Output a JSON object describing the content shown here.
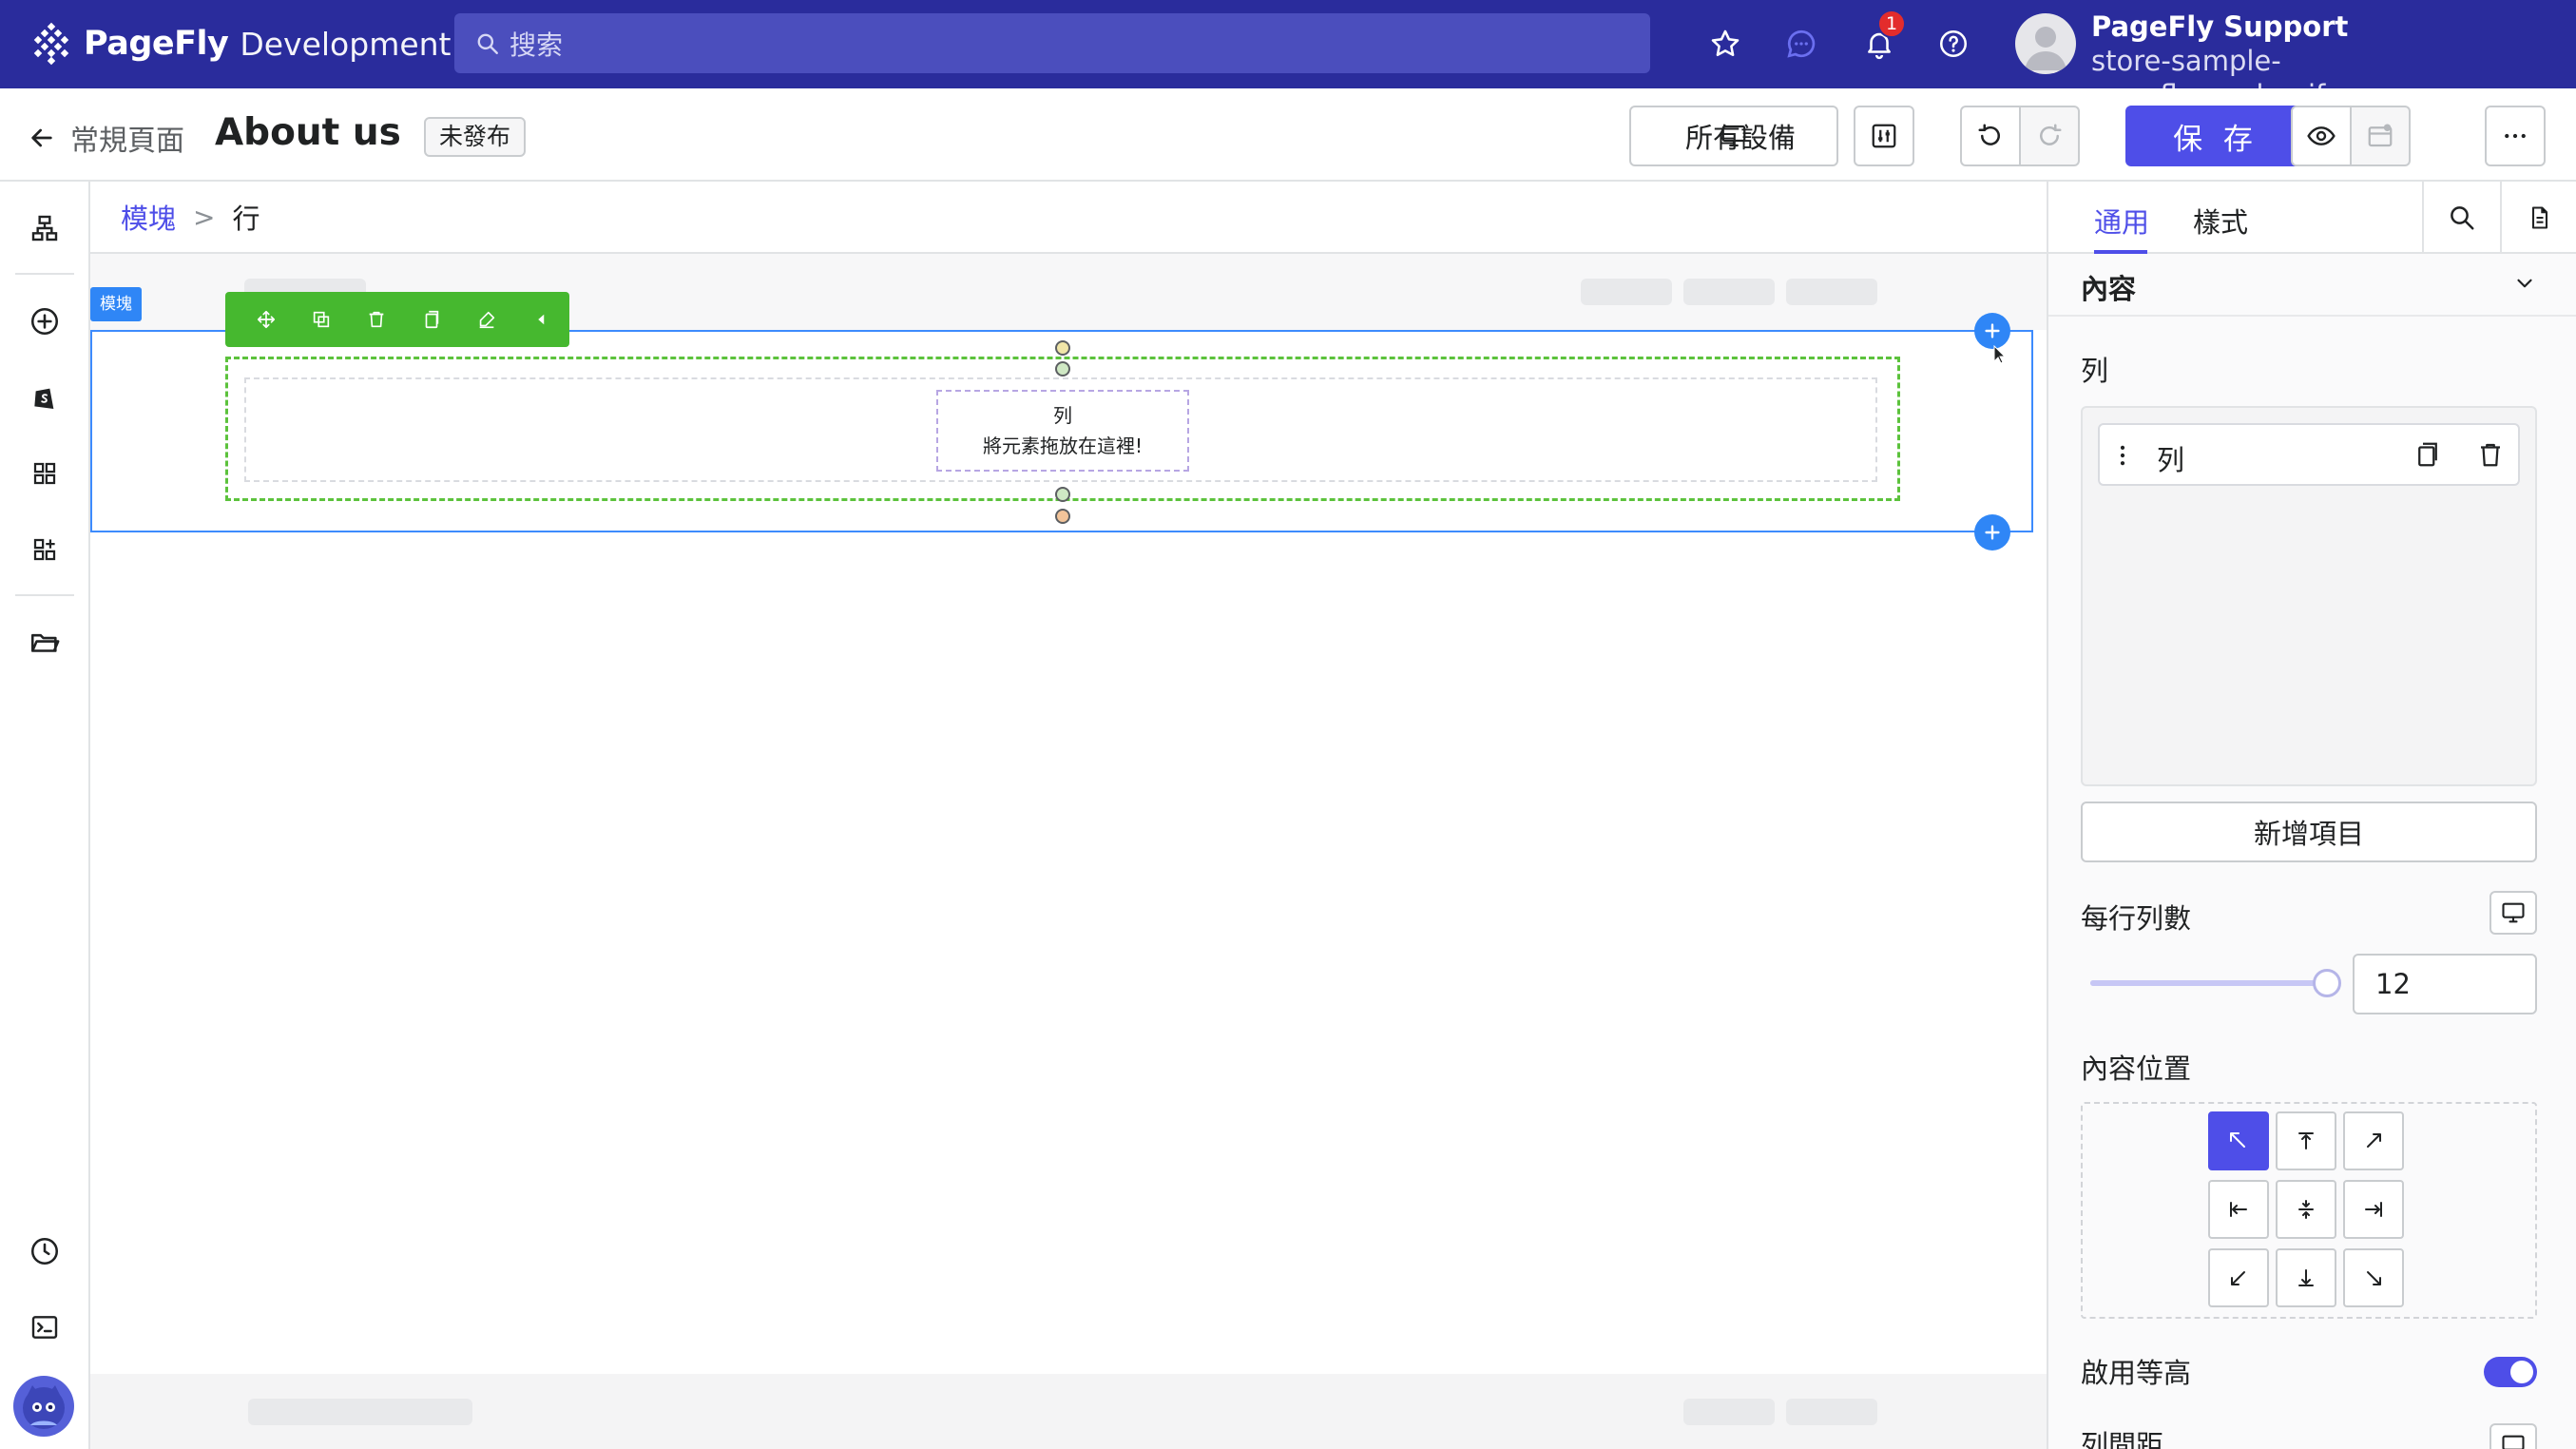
{
  "topbar": {
    "brand_name": "PageFly",
    "brand_suffix": "Development",
    "search_placeholder": "搜索",
    "notification_count": "1",
    "user_name": "PageFly Support",
    "user_store": "store-sample-pagefly.myshopify.com"
  },
  "header": {
    "back_label": "常規頁面",
    "page_title": "About us",
    "status_badge": "未發布",
    "device_label": "所有設備",
    "save_label": "保 存"
  },
  "breadcrumb": {
    "parent": "模塊",
    "separator": ">",
    "current": "行"
  },
  "canvas": {
    "section_tag": "模塊",
    "column_label": "列",
    "drop_hint": "將元素拖放在這裡!"
  },
  "panel": {
    "tab_general": "通用",
    "tab_style": "樣式",
    "section_title": "內容",
    "columns_label": "列",
    "column_item": "列",
    "add_item": "新增項目",
    "per_row_label": "每行列數",
    "per_row_value": "12",
    "content_position_label": "內容位置",
    "equal_height_label": "啟用等高",
    "gap_label": "列間距",
    "equal_height_enabled": true
  },
  "colors": {
    "topbar": "#2a2c9c",
    "accent": "#4e4ee8",
    "selection_blue": "#2f86f6",
    "toolbar_green": "#46b82f"
  }
}
